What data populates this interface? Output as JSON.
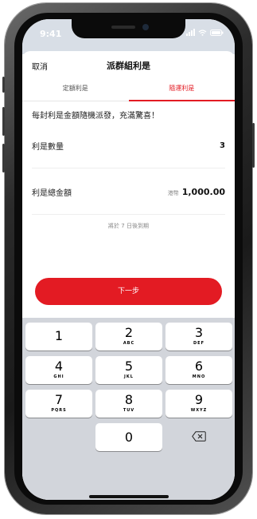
{
  "status_bar": {
    "time": "9:41"
  },
  "nav": {
    "cancel_label": "取消",
    "title": "派群組利是"
  },
  "tabs": [
    {
      "label": "定額利是",
      "active": false
    },
    {
      "label": "隨運利是",
      "active": true
    }
  ],
  "form": {
    "description": "每封利是金額隨機派發，充滿驚喜！",
    "quantity_label": "利是數量",
    "quantity_value": "3",
    "total_label": "利是總金額",
    "currency": "港幣",
    "total_value": "1,000.00",
    "expiry_note": "將於 7 日後到期"
  },
  "next_button_label": "下一步",
  "keypad": {
    "keys": [
      {
        "digit": "1",
        "letters": ""
      },
      {
        "digit": "2",
        "letters": "ABC"
      },
      {
        "digit": "3",
        "letters": "DEF"
      },
      {
        "digit": "4",
        "letters": "GHI"
      },
      {
        "digit": "5",
        "letters": "JKL"
      },
      {
        "digit": "6",
        "letters": "MNO"
      },
      {
        "digit": "7",
        "letters": "PQRS"
      },
      {
        "digit": "8",
        "letters": "TUV"
      },
      {
        "digit": "9",
        "letters": "WXYZ"
      },
      {
        "digit": "0",
        "letters": ""
      }
    ],
    "delete_icon": "backspace-icon"
  },
  "colors": {
    "accent": "#e31b23",
    "keypad_bg": "#d2d5db",
    "status_bar_bg": "#d8dee6"
  }
}
